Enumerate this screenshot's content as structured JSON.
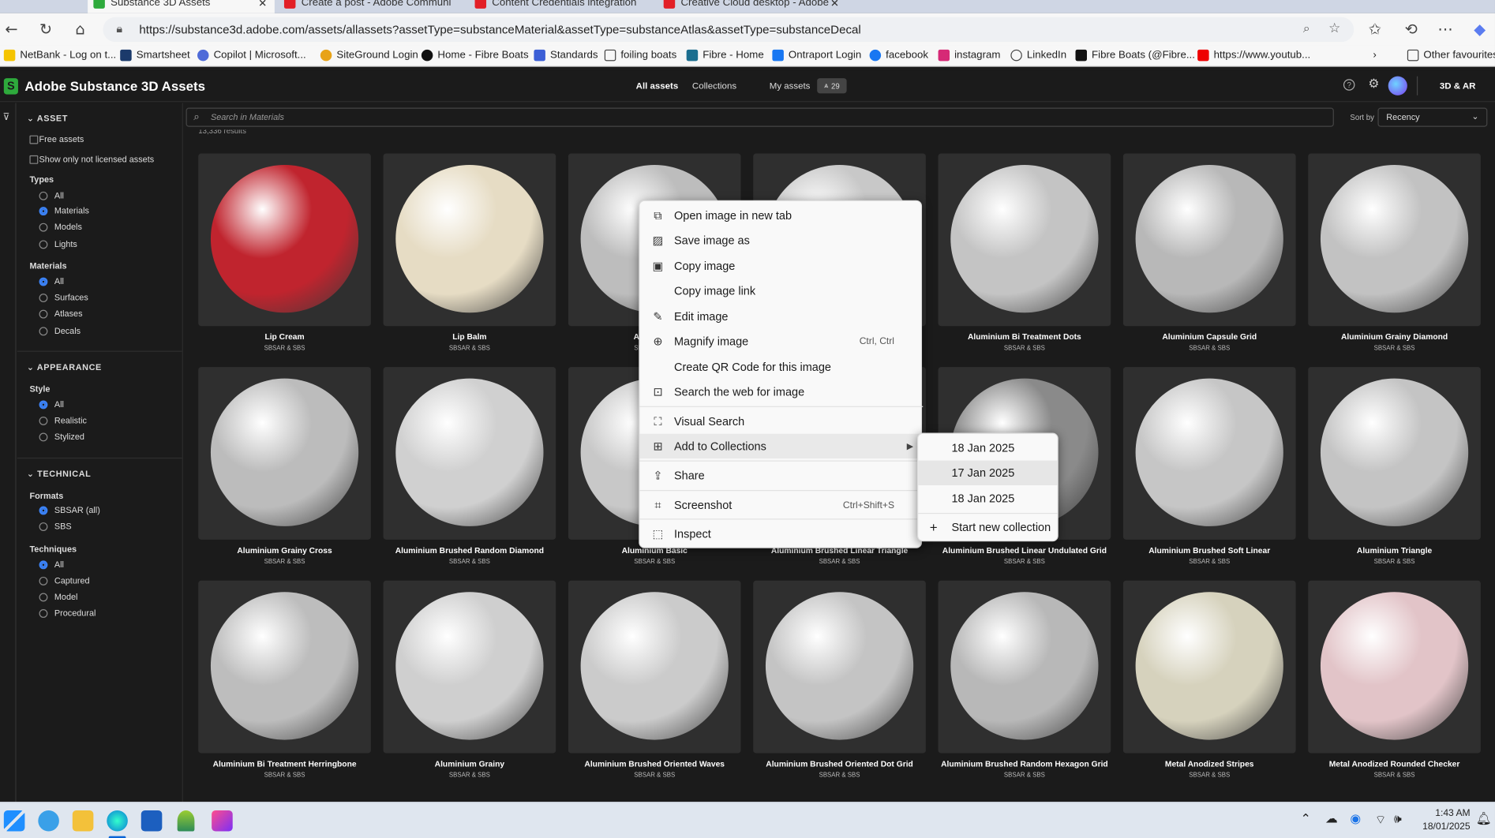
{
  "browser": {
    "tabs": [
      {
        "title": "Substance 3D Assets",
        "active": true
      },
      {
        "title": "Create a post - Adobe Communi"
      },
      {
        "title": "Content Credentials integration"
      },
      {
        "title": "Creative Cloud desktop - Adobe"
      }
    ],
    "url": "https://substance3d.adobe.com/assets/allassets?assetType=substanceMaterial&assetType=substanceAtlas&assetType=substanceDecal",
    "favorites": [
      "NetBank - Log on t...",
      "Smartsheet",
      "Copilot | Microsoft...",
      "SiteGround Login",
      "Home - Fibre Boats",
      "Standards",
      "foiling boats",
      "Fibre - Home",
      "Ontraport Login",
      "facebook",
      "instagram",
      "LinkedIn",
      "Fibre Boats (@Fibre...",
      "https://www.youtub..."
    ],
    "other_favourites": "Other favourites"
  },
  "app": {
    "title": "Adobe Substance 3D Assets",
    "nav": {
      "all_assets": "All assets",
      "collections": "Collections",
      "my_assets": "My assets",
      "badge": "29"
    },
    "ar_label": "3D & AR"
  },
  "sidebar": {
    "asset_header": "ASSET",
    "free_assets": "Free assets",
    "not_licensed": "Show only not licensed assets",
    "types_label": "Types",
    "types": [
      "All",
      "Materials",
      "Models",
      "Lights"
    ],
    "types_selected": "Materials",
    "materials_label": "Materials",
    "materials": [
      "All",
      "Surfaces",
      "Atlases",
      "Decals"
    ],
    "appearance_header": "APPEARANCE",
    "style_label": "Style",
    "styles": [
      "All",
      "Realistic",
      "Stylized"
    ],
    "technical_header": "TECHNICAL",
    "formats_label": "Formats",
    "formats": [
      "SBSAR (all)",
      "SBS"
    ],
    "techniques_label": "Techniques",
    "techniques": [
      "All",
      "Captured",
      "Model",
      "Procedural"
    ]
  },
  "search": {
    "placeholder": "Search in Materials",
    "sort_label": "Sort by",
    "sort_value": "Recency",
    "results": "13,336 results"
  },
  "assets": [
    {
      "name": "Lip Cream",
      "sub": "SBSAR & SBS",
      "color": "#c0242e"
    },
    {
      "name": "Lip Balm",
      "sub": "SBSAR & SBS",
      "color": "#e6dcc4"
    },
    {
      "name": "Aluminium",
      "sub": "SBSAR & SBS",
      "color": "#bdbdbd"
    },
    {
      "name": "",
      "sub": "SBSAR & SBS",
      "color": "#c8c8c8"
    },
    {
      "name": "Aluminium Bi Treatment Dots",
      "sub": "SBSAR & SBS",
      "color": "#c4c4c4"
    },
    {
      "name": "Aluminium Capsule Grid",
      "sub": "SBSAR & SBS",
      "color": "#b8b8b8"
    },
    {
      "name": "Aluminium Grainy Diamond",
      "sub": "SBSAR & SBS",
      "color": "#c2c2c2"
    },
    {
      "name": "Aluminium Grainy Cross",
      "sub": "SBSAR & SBS",
      "color": "#bcbcbc"
    },
    {
      "name": "Aluminium Brushed Random Diamond",
      "sub": "SBSAR & SBS",
      "color": "#d0d0d0"
    },
    {
      "name": "Aluminium Basic",
      "sub": "SBSAR & SBS",
      "color": "#c8c8c8"
    },
    {
      "name": "Aluminium Brushed Linear Triangle",
      "sub": "SBSAR & SBS",
      "color": "#c8c8c8"
    },
    {
      "name": "Aluminium Brushed Linear Undulated Grid",
      "sub": "SBSAR & SBS",
      "color": "#8a8a8a"
    },
    {
      "name": "Aluminium Brushed Soft Linear",
      "sub": "SBSAR & SBS",
      "color": "#c6c6c6"
    },
    {
      "name": "Aluminium Triangle",
      "sub": "SBSAR & SBS",
      "color": "#c4c4c4"
    },
    {
      "name": "Aluminium Bi Treatment Herringbone",
      "sub": "SBSAR & SBS",
      "color": "#bdbdbd"
    },
    {
      "name": "Aluminium Grainy",
      "sub": "SBSAR & SBS",
      "color": "#cfcfcf"
    },
    {
      "name": "Aluminium Brushed Oriented Waves",
      "sub": "SBSAR & SBS",
      "color": "#cbcbcb"
    },
    {
      "name": "Aluminium Brushed Oriented Dot Grid",
      "sub": "SBSAR & SBS",
      "color": "#c4c4c4"
    },
    {
      "name": "Aluminium Brushed Random Hexagon Grid",
      "sub": "SBSAR & SBS",
      "color": "#b8b8b8"
    },
    {
      "name": "Metal Anodized Stripes",
      "sub": "SBSAR & SBS",
      "color": "#d6d2bd"
    },
    {
      "name": "Metal Anodized Rounded Checker",
      "sub": "SBSAR & SBS",
      "color": "#e2c4c8"
    }
  ],
  "context_menu": {
    "items": [
      {
        "label": "Open image in new tab",
        "icon": "new-tab-icon"
      },
      {
        "label": "Save image as",
        "icon": "save-image-icon"
      },
      {
        "label": "Copy image",
        "icon": "copy-image-icon"
      },
      {
        "label": "Copy image link",
        "icon": ""
      },
      {
        "label": "Edit image",
        "icon": "edit-image-icon"
      },
      {
        "label": "Magnify image",
        "icon": "magnify-icon",
        "shortcut": "Ctrl, Ctrl"
      },
      {
        "label": "Create QR Code for this image",
        "icon": ""
      },
      {
        "label": "Search the web for image",
        "icon": "search-web-icon"
      },
      {
        "label": "Visual Search",
        "icon": "visual-search-icon"
      },
      {
        "label": "Add to Collections",
        "icon": "collections-icon"
      },
      {
        "label": "Share",
        "icon": "share-icon"
      },
      {
        "label": "Screenshot",
        "icon": "screenshot-icon",
        "shortcut": "Ctrl+Shift+S"
      },
      {
        "label": "Inspect",
        "icon": "inspect-icon"
      }
    ],
    "submenu": [
      "18 Jan 2025",
      "17 Jan 2025",
      "18 Jan 2025",
      "Start new collection"
    ]
  },
  "taskbar": {
    "time": "1:43 AM",
    "date": "18/01/2025"
  }
}
